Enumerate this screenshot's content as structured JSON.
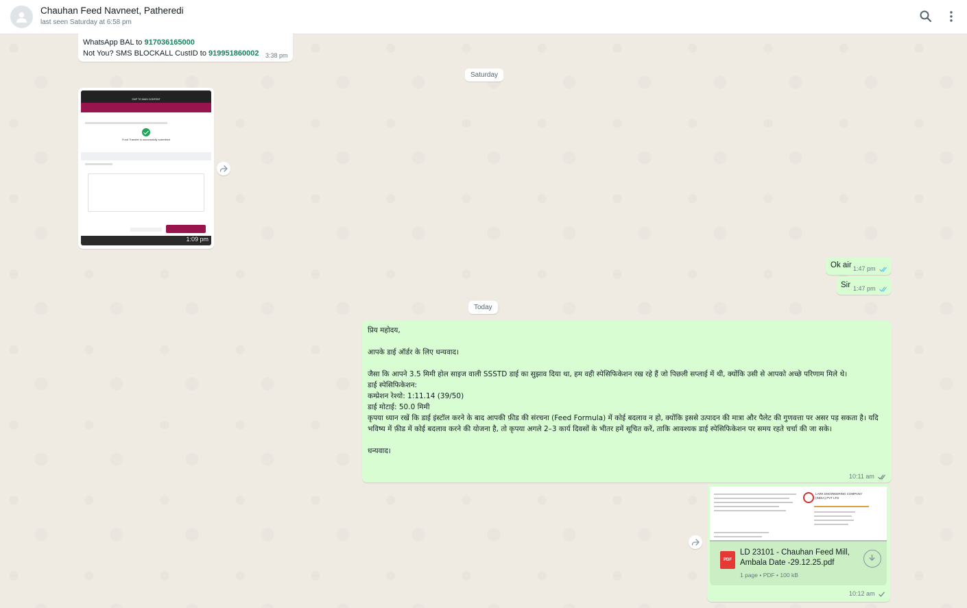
{
  "header": {
    "contact_name": "Chauhan Feed Navneet, Patheredi",
    "last_seen": "last seen Saturday at 6:58 pm",
    "icons": [
      "person-icon",
      "search-icon",
      "menu-dots-icon"
    ]
  },
  "messages": {
    "m1": {
      "line1_prefix": "WhatsApp BAL to ",
      "line1_number": "917036165000",
      "line2_prefix": "Not You? SMS BLOCKALL CustID to ",
      "line2_number": "919951860002",
      "time": "3:38 pm"
    },
    "date_saturday": "Saturday",
    "m2": {
      "thumb_skip": "SKIP TO MAIN CONTENT",
      "thumb_caption": "Fund Transfer is successfully submitted",
      "time": "1:09 pm"
    },
    "m3": {
      "text": "Ok air",
      "time": "1:47 pm"
    },
    "m4": {
      "text": "Sir",
      "time": "1:47 pm"
    },
    "date_today": "Today",
    "m5": {
      "text": "प्रिय महोदय,\n\nआपके डाई ऑर्डर के लिए धन्यवाद।\n\nजैसा कि आपने 3.5 मिमी होल साइज वाली SSSTD डाई का सुझाव दिया था, हम वही स्पेसिफिकेशन रख रहे हैं जो पिछली सप्लाई में थी, क्योंकि उसी से आपको अच्छे परिणाम मिले थे।\nडाई स्पेसिफिकेशन:\nकम्प्रेशन रेश्यो: 1:11.14 (39/50)\nडाई मोटाई: 50.0 मिमी\nकृपया ध्यान रखें कि डाई इंस्टॉल करने के बाद आपकी फ़ीड की संरचना (Feed Formula) में कोई बदलाव न हो, क्योंकि इससे उत्पादन की मात्रा और पैलेट की गुणवत्ता पर असर पड़ सकता है। यदि भविष्य में फ़ीड में कोई बदलाव करने की योजना है, तो कृपया अगले 2–3 कार्य दिवसों के भीतर हमें सूचित करें, ताकि आवश्यक डाई स्पेसिफिकेशन पर समय रहते चर्चा की जा सके।\n\nधन्यवाद।",
      "time": "10:11 am"
    },
    "m6": {
      "preview_company": "LARK ENGINEERING COMPANY (INDIA) PVT LTD",
      "icon_label": "PDF",
      "doc_name": "LD 23101 - Chauhan Feed Mill, Ambala Date -29.12.25.pdf",
      "doc_meta": "1 page • PDF • 100 kB",
      "time": "10:12 am"
    }
  },
  "colors": {
    "chat_bg": "#efeae2",
    "incoming": "#ffffff",
    "outgoing": "#d9fdd3",
    "read_ticks": "#53bdeb",
    "link_green": "#1a7f5a"
  }
}
